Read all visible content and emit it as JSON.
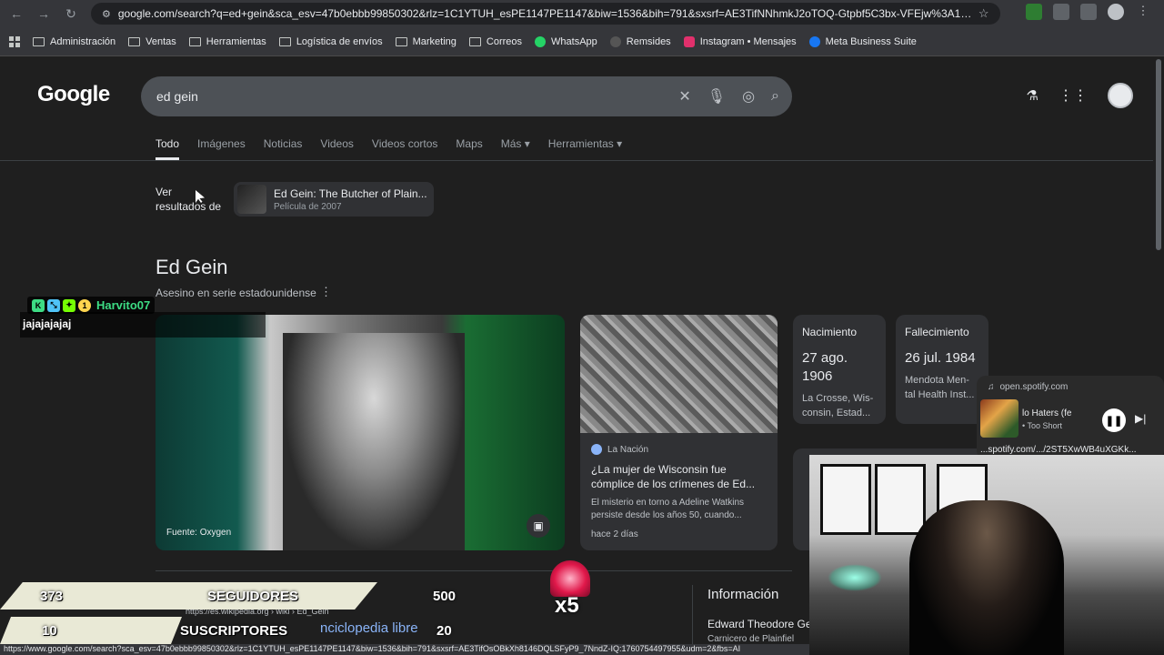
{
  "browser": {
    "url": "google.com/search?q=ed+gein&sca_esv=47b0ebbb99850302&rlz=1C1YTUH_esPE1147PE1147&biw=1536&bih=791&sxsrf=AE3TifNNhmkJ2oTOQ-Gtpbf5C3bx-VFEjw%3A1760754...",
    "status_url": "https://www.google.com/search?sca_esv=47b0ebbb99850302&rlz=1C1YTUH_esPE1147PE1147&biw=1536&bih=791&sxsrf=AE3TifOsOBkXh8146DQLSFyP9_7NndZ-IQ:1760754497955&udm=2&fbs=AI"
  },
  "bookmarks": [
    {
      "label": "Administración",
      "icon": "folder-icon"
    },
    {
      "label": "Ventas",
      "icon": "folder-icon"
    },
    {
      "label": "Herramientas",
      "icon": "folder-icon"
    },
    {
      "label": "Logística de envíos",
      "icon": "folder-icon"
    },
    {
      "label": "Marketing",
      "icon": "folder-icon"
    },
    {
      "label": "Correos",
      "icon": "folder-icon"
    },
    {
      "label": "WhatsApp",
      "icon": "whatsapp-icon"
    },
    {
      "label": "Remsides",
      "icon": "remsides-icon"
    },
    {
      "label": "Instagram • Mensajes",
      "icon": "instagram-icon"
    },
    {
      "label": "Meta Business Suite",
      "icon": "meta-icon"
    }
  ],
  "google": {
    "logo": "Google",
    "query": "ed gein",
    "tabs": [
      "Todo",
      "Imágenes",
      "Noticias",
      "Videos",
      "Videos cortos",
      "Maps",
      "Más ▾",
      "Herramientas ▾"
    ],
    "ver_resultados": "Ver\nresultados de",
    "movie": {
      "title": "Ed Gein: The Butcher of Plain...",
      "subtitle": "Película de 2007"
    }
  },
  "knowledge_panel": {
    "title": "Ed Gein",
    "subtitle": "Asesino en serie estadounidense",
    "photo_source": "Fuente: Oxygen",
    "news": {
      "source": "La Nación",
      "title": "¿La mujer de Wisconsin fue cómplice de los crímenes de Ed...",
      "body": "El misterio en torno a Adeline Watkins persiste desde los años 50, cuando...",
      "time": "hace 2 días"
    },
    "facts": [
      {
        "label": "Nacimiento",
        "date": "27 ago. 1906",
        "place": "La Crosse, Wis- consin, Estad..."
      },
      {
        "label": "Fallecimiento",
        "date": "26 jul. 1984",
        "place": "Mendota Men- tal Health Inst..."
      }
    ],
    "wiki_url": "https://es.wikipedia.org › wiki › Ed_Gein",
    "info_title": "Información",
    "info_line": "Edward Theodore Ge",
    "info_line2": "Carnicero de Plainfiel"
  },
  "stream_overlay": {
    "chat_user": "Harvito07",
    "chat_msg": "jajajajajaj",
    "seguidores_count": "373",
    "seguidores_label": "SEGUIDORES",
    "seguidores_goal": "500",
    "subs_count": "10",
    "subs_label": "SUSCRIPTORES",
    "subs_goal": "20",
    "wiki_tail": "nciclopedia libre",
    "multiplier": "x5"
  },
  "spotify": {
    "site": "open.spotify.com",
    "title": "lo Haters (fe",
    "artist": "• Too Short",
    "link": "...spotify.com/.../2ST5XwWB4uXGKk..."
  }
}
